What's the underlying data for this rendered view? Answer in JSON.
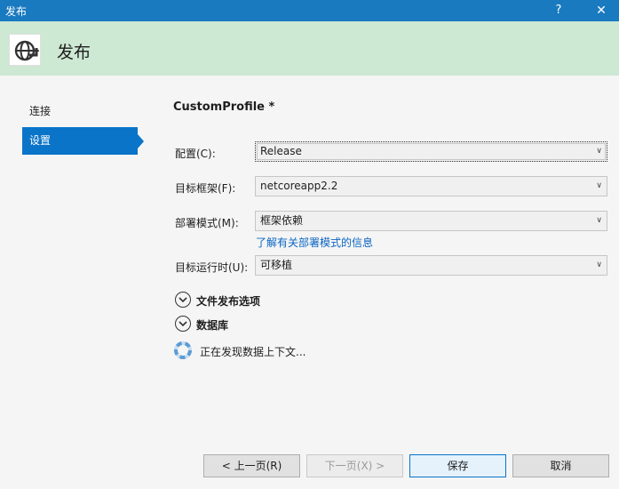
{
  "window": {
    "title": "发布",
    "help": "?",
    "close": "✕"
  },
  "header": {
    "title": "发布",
    "logo_icon": "globe-publish-icon"
  },
  "nav": {
    "items": [
      {
        "label": "连接"
      },
      {
        "label": "设置"
      }
    ],
    "active_index": 1
  },
  "profile": {
    "name": "CustomProfile *"
  },
  "form": {
    "configuration": {
      "label": "配置(C):",
      "value": "Release"
    },
    "target_framework": {
      "label": "目标框架(F):",
      "value": "netcoreapp2.2"
    },
    "deployment_mode": {
      "label": "部署模式(M):",
      "value": "框架依赖",
      "link": "了解有关部署模式的信息"
    },
    "target_runtime": {
      "label": "目标运行时(U):",
      "value": "可移植"
    }
  },
  "sections": {
    "file_publish_options": "文件发布选项",
    "databases": "数据库"
  },
  "status": {
    "text": "正在发现数据上下文..."
  },
  "buttons": {
    "prev": "< 上一页(R)",
    "next": "下一页(X) >",
    "save": "保存",
    "cancel": "取消"
  },
  "colors": {
    "titlebar": "#1a7ac0",
    "header_bg": "#cde8d3",
    "accent": "#0a74c8",
    "link": "#0a66c2"
  }
}
